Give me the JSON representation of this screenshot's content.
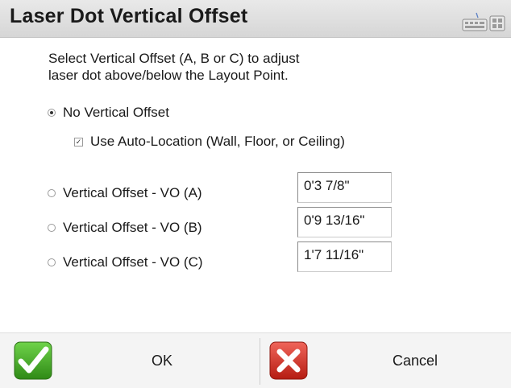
{
  "window": {
    "title": "Laser Dot Vertical Offset",
    "keyboard_icon": "keyboard-icon"
  },
  "instructions": {
    "line1": "Select Vertical Offset (A, B or C) to adjust",
    "line2": "laser dot above/below the Layout Point."
  },
  "options": {
    "no_offset": {
      "label": "No Vertical Offset",
      "selected": true
    },
    "auto_location": {
      "label": "Use Auto-Location  (Wall, Floor, or Ceiling)",
      "checked": true
    },
    "vo_a": {
      "label": "Vertical Offset - VO (A)",
      "selected": false,
      "value": "0'3 7/8\""
    },
    "vo_b": {
      "label": "Vertical Offset - VO (B)",
      "selected": false,
      "value": "0'9 13/16\""
    },
    "vo_c": {
      "label": "Vertical Offset - VO (C)",
      "selected": false,
      "value": "1'7 11/16\""
    }
  },
  "buttons": {
    "ok": {
      "label": "OK",
      "icon": "checkmark-icon",
      "color": "#3a9a1e"
    },
    "cancel": {
      "label": "Cancel",
      "icon": "close-x-icon",
      "color": "#d12a1f"
    }
  }
}
